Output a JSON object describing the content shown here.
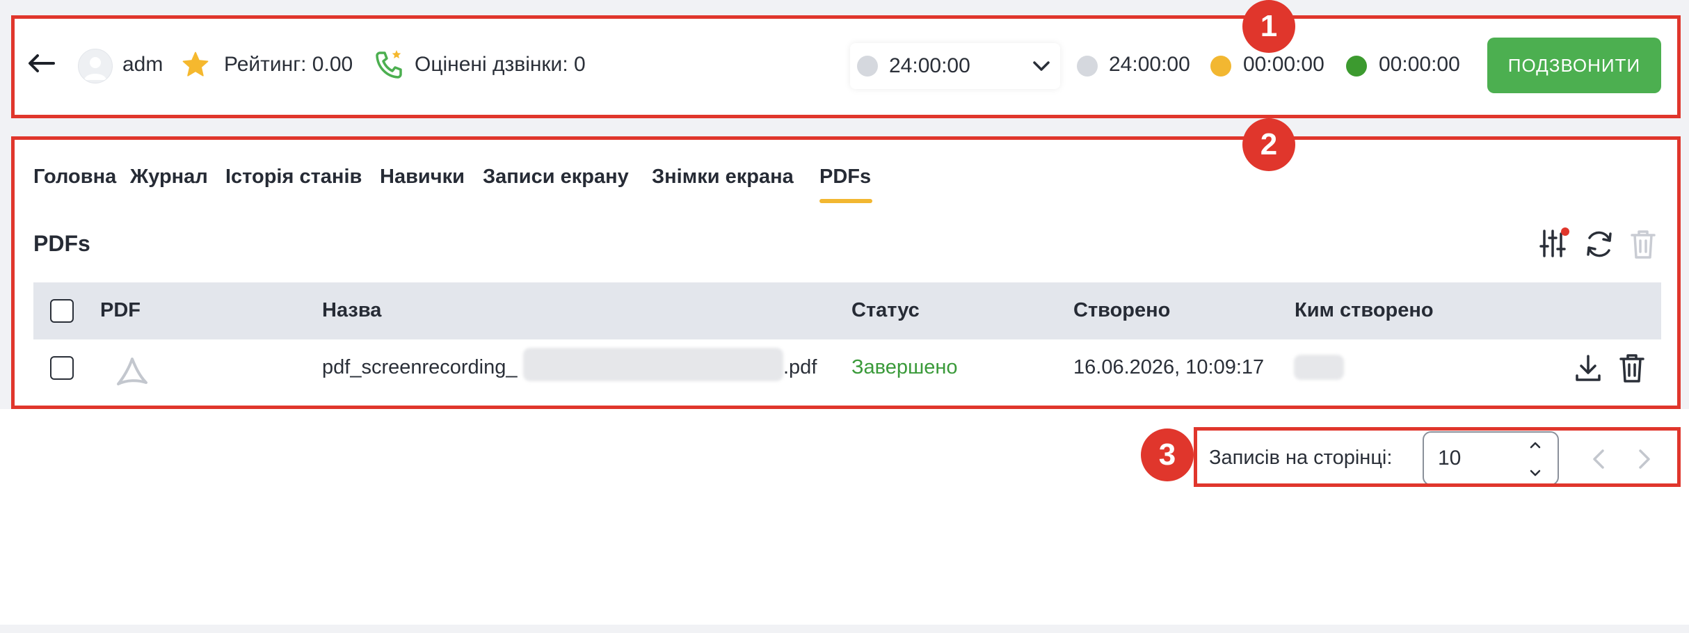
{
  "header": {
    "username": "adm",
    "rating": "Рейтинг: 0.00",
    "rated_calls": "Оцінені дзвінки: 0",
    "status_select_value": "24:00:00",
    "timer_gray": "24:00:00",
    "timer_yellow": "00:00:00",
    "timer_green": "00:00:00",
    "call_button": "ПОДЗВОНИТИ"
  },
  "tabs": [
    "Головна",
    "Журнал",
    "Історія станів",
    "Навички",
    "Записи екрану",
    "Знімки екрана",
    "PDFs"
  ],
  "active_tab": "PDFs",
  "section": {
    "title": "PDFs"
  },
  "table": {
    "columns": [
      "PDF",
      "Назва",
      "Статус",
      "Створено",
      "Ким створено"
    ],
    "rows": [
      {
        "name_prefix": "pdf_screenrecording_",
        "name_suffix": ".pdf",
        "status": "Завершено",
        "created": "16.06.2026, 10:09:17"
      }
    ]
  },
  "pagination": {
    "label": "Записів на сторінці:",
    "per_page": "10"
  },
  "markers": [
    "1",
    "2",
    "3"
  ],
  "colors": {
    "accent_green": "#4caf50",
    "status_green": "#3a9a3a",
    "tab_underline": "#f2b731",
    "annotation_red": "#e0362c",
    "dot_gray": "#d5d8de",
    "dot_yellow": "#f2b731",
    "dot_green": "#3c9a2f"
  }
}
